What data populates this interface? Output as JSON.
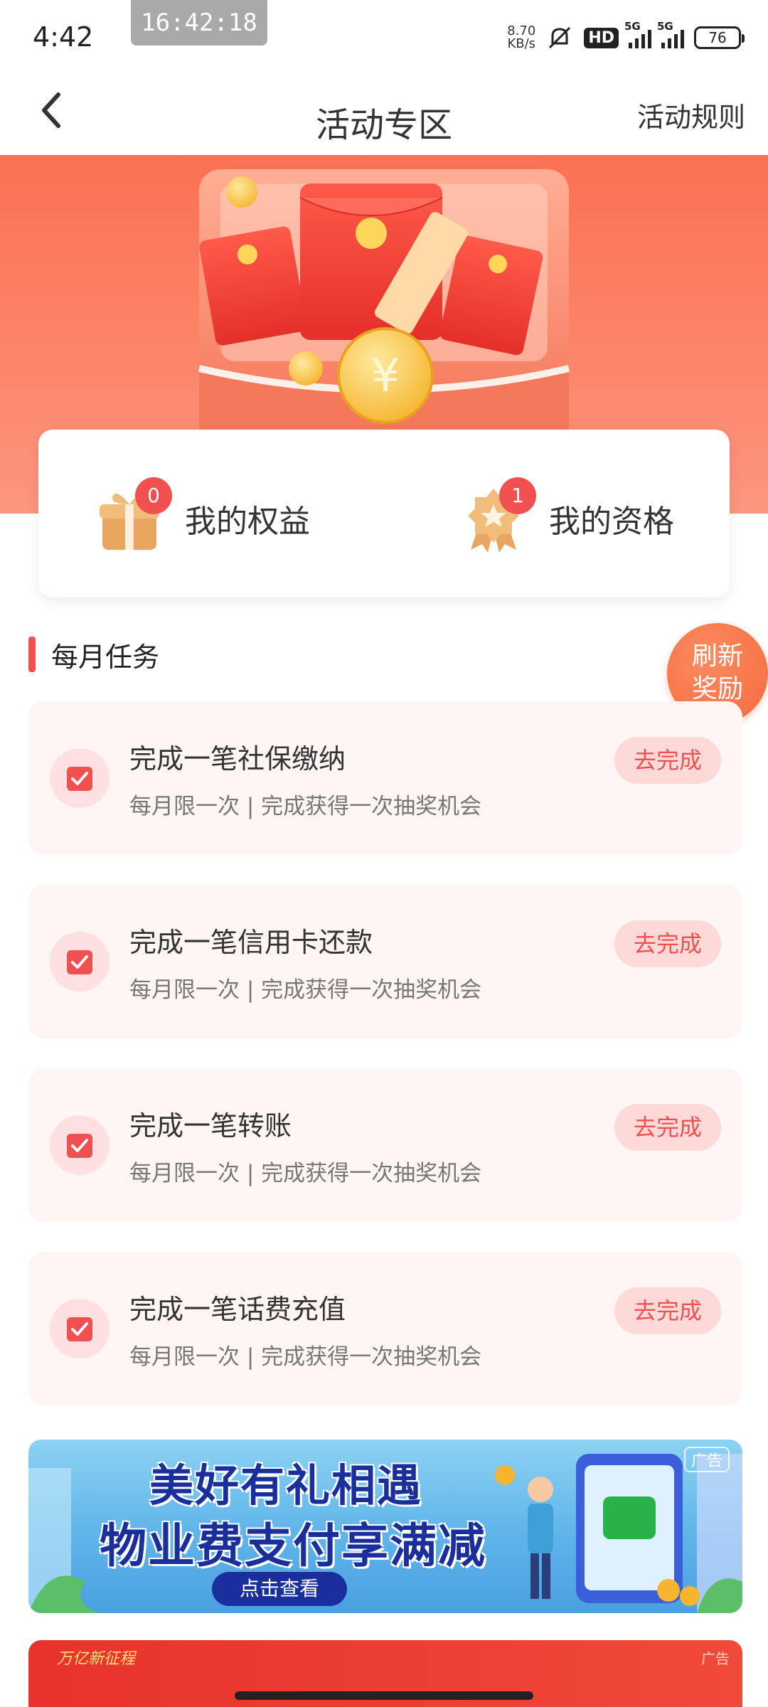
{
  "status_bar": {
    "time": "4:42",
    "clock_pill": "16:42:18",
    "net_speed_value": "8.70",
    "net_speed_unit": "KB/s",
    "hd": "HD",
    "signal1": "5G",
    "signal2": "5G",
    "battery": "76"
  },
  "nav": {
    "title": "活动专区",
    "rules": "活动规则"
  },
  "benefits": {
    "my_rights_label": "我的权益",
    "my_rights_count": "0",
    "my_qualification_label": "我的资格",
    "my_qualification_count": "1"
  },
  "section": {
    "title": "每月任务"
  },
  "refresh": {
    "line1": "刷新",
    "line2": "奖励"
  },
  "tasks": [
    {
      "title": "完成一笔社保缴纳",
      "desc": "每月限一次 | 完成获得一次抽奖机会",
      "button": "去完成"
    },
    {
      "title": "完成一笔信用卡还款",
      "desc": "每月限一次 | 完成获得一次抽奖机会",
      "button": "去完成"
    },
    {
      "title": "完成一笔转账",
      "desc": "每月限一次 | 完成获得一次抽奖机会",
      "button": "去完成"
    },
    {
      "title": "完成一笔话费充值",
      "desc": "每月限一次 | 完成获得一次抽奖机会",
      "button": "去完成"
    }
  ],
  "ads": [
    {
      "tag": "广告",
      "line1": "美好有礼相遇",
      "line2": "物业费支付享满减",
      "cta": "点击查看"
    },
    {
      "tag": "广告",
      "brand": "万亿新征程"
    }
  ],
  "colors": {
    "accent": "#f0504f",
    "hero_top": "#fb7153",
    "card_bg": "#fff5f4",
    "refresh": "#f56a3e"
  },
  "icons": {
    "back": "chevron-left-icon",
    "gift": "gift-box-icon",
    "medal": "award-medal-icon",
    "check": "checkbox-checked-icon"
  }
}
